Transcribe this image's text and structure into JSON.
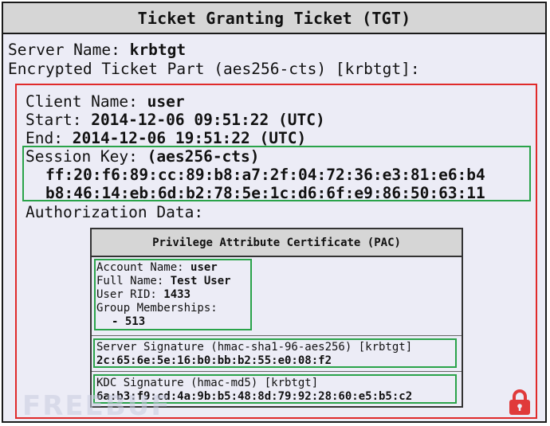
{
  "title": "Ticket Granting Ticket (TGT)",
  "server_name_label": "Server Name:",
  "server_name_value": "krbtgt",
  "encrypted_part": "Encrypted Ticket Part (aes256-cts) [krbtgt]:",
  "client_name_label": "Client Name:",
  "client_name_value": "user",
  "start_label": "Start:",
  "start_value": "2014-12-06 09:51:22 (UTC)",
  "end_label": "End:",
  "end_value": "2014-12-06 19:51:22 (UTC)",
  "session_key_label": "Session Key:",
  "session_key_type": "(aes256-cts)",
  "session_key_line1": "ff:20:f6:89:cc:89:b8:a7:2f:04:72:36:e3:81:e6:b4",
  "session_key_line2": "b8:46:14:eb:6d:b2:78:5e:1c:d6:6f:e9:86:50:63:11",
  "authorization_data": "Authorization Data:",
  "pac": {
    "title": "Privilege Attribute Certificate (PAC)",
    "account_name_label": "Account Name:",
    "account_name_value": "user",
    "full_name_label": "Full Name:",
    "full_name_value": "Test User",
    "user_rid_label": "User RID:",
    "user_rid_value": "1433",
    "group_memberships_label": "Group Memberships:",
    "group_member": "- 513",
    "server_signature_label": "Server Signature (hmac-sha1-96-aes256) [krbtgt]",
    "server_signature_value": "2c:65:6e:5e:16:b0:bb:b2:55:e0:08:f2",
    "kdc_signature_label": "KDC Signature (hmac-md5) [krbtgt]",
    "kdc_signature_value": "6a:b3:f9:cd:4a:9b:b5:48:8d:79:92:28:60:e5:b5:c2"
  },
  "watermark": "FREEBUF",
  "icons": {
    "lock": "lock-icon"
  },
  "colors": {
    "red_box": "#e02a2a",
    "green_box": "#2aa34a",
    "lock": "#e03a3a"
  }
}
